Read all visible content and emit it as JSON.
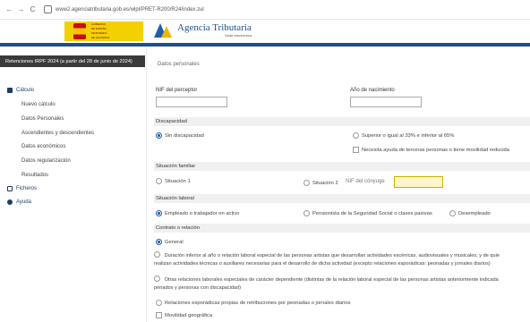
{
  "browser": {
    "back": "←",
    "forward": "→",
    "reload": "C",
    "url": "www2.agenciatributaria.gob.es/wlpl/PRET-R200/R24/index.zul"
  },
  "header": {
    "gov_lines": [
      "GOBIERNO",
      "DE ESPAÑA",
      "MINISTERIO",
      "DE HACIENDA"
    ],
    "brand_title": "Agencia Tributaria",
    "brand_subtitle": "Sede electrónica"
  },
  "sidebar": {
    "banner": "Retenciones IRPF 2024 (a partir del 28 de junio de 2024)",
    "calculo": "Cálculo",
    "calculo_items": [
      "Nuevo cálculo",
      "Datos Personales",
      "Ascendientes y descendientes",
      "Datos económicos",
      "Datos regularización",
      "Resultados"
    ],
    "ficheros": "Ficheros",
    "ayuda": "Ayuda"
  },
  "main": {
    "section_title": "Datos personales",
    "nif_label": "NIF del perceptor",
    "nif_value": "",
    "birth_label": "Año de nacimiento",
    "birth_value": "",
    "discapacidad": {
      "title": "Discapacidad",
      "sin": "Sin discapacidad",
      "superior": "Superior o igual al 33% e inferior al 65%",
      "ayuda": "Necesita ayuda de terceras personas o tiene movilidad reducida"
    },
    "familiar": {
      "title": "Situación familiar",
      "s1": "Situación 1",
      "s2": "Situación 2",
      "nif_conyuge": "NIF del cónyuge",
      "nif_conyuge_value": ""
    },
    "laboral": {
      "title": "Situación laboral",
      "empleado": "Empleado o trabajador en activo",
      "pensionista": "Pensionista de la Seguridad Social o clases pasivas",
      "desempleado": "Desempleado"
    },
    "contrato": {
      "title": "Contrato o relación",
      "general": "General",
      "duracion": "Duración inferior al año o relación laboral especial de las personas artistas que desarrollan actividades escénicas, audiovisuales y musicales, y de quie",
      "duracion_2": "realizan actividades técnicas o auxiliares necesarias para el desarrollo de dicha actividad (excepto relaciones esporádicas: peonadas y jornales diarios)",
      "otras": "Otras relaciones laborales especiales de carácter dependiente (distintas de la relación laboral especial de las personas artistas anteriormente indicada",
      "otras_2": "penados y personas con discapacidad)",
      "esporadicas": "Relaciones esporádicas propias de retribuciones por peonadas o jornales diarios",
      "movilidad": "Movilidad geográfica"
    }
  }
}
